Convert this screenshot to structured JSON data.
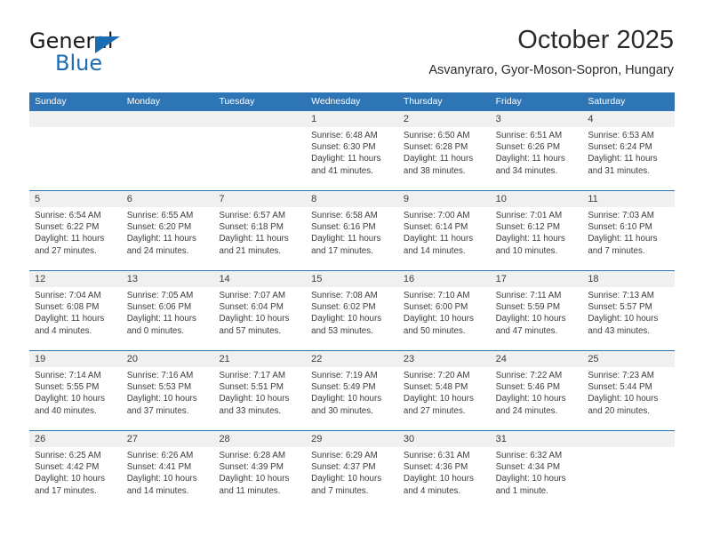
{
  "brand": {
    "name_part1": "General",
    "name_part2": "Blue",
    "triangle_color": "#1b6cb3",
    "blue_color": "#1b6cb3"
  },
  "header": {
    "title": "October 2025",
    "subtitle": "Asvanyraro, Gyor-Moson-Sopron, Hungary",
    "accent_color": "#2e75b6"
  },
  "calendar": {
    "weekday_headers": [
      "Sunday",
      "Monday",
      "Tuesday",
      "Wednesday",
      "Thursday",
      "Friday",
      "Saturday"
    ],
    "weeks": [
      [
        {
          "day": "",
          "lines": []
        },
        {
          "day": "",
          "lines": []
        },
        {
          "day": "",
          "lines": []
        },
        {
          "day": "1",
          "lines": [
            "Sunrise: 6:48 AM",
            "Sunset: 6:30 PM",
            "Daylight: 11 hours",
            "and 41 minutes."
          ]
        },
        {
          "day": "2",
          "lines": [
            "Sunrise: 6:50 AM",
            "Sunset: 6:28 PM",
            "Daylight: 11 hours",
            "and 38 minutes."
          ]
        },
        {
          "day": "3",
          "lines": [
            "Sunrise: 6:51 AM",
            "Sunset: 6:26 PM",
            "Daylight: 11 hours",
            "and 34 minutes."
          ]
        },
        {
          "day": "4",
          "lines": [
            "Sunrise: 6:53 AM",
            "Sunset: 6:24 PM",
            "Daylight: 11 hours",
            "and 31 minutes."
          ]
        }
      ],
      [
        {
          "day": "5",
          "lines": [
            "Sunrise: 6:54 AM",
            "Sunset: 6:22 PM",
            "Daylight: 11 hours",
            "and 27 minutes."
          ]
        },
        {
          "day": "6",
          "lines": [
            "Sunrise: 6:55 AM",
            "Sunset: 6:20 PM",
            "Daylight: 11 hours",
            "and 24 minutes."
          ]
        },
        {
          "day": "7",
          "lines": [
            "Sunrise: 6:57 AM",
            "Sunset: 6:18 PM",
            "Daylight: 11 hours",
            "and 21 minutes."
          ]
        },
        {
          "day": "8",
          "lines": [
            "Sunrise: 6:58 AM",
            "Sunset: 6:16 PM",
            "Daylight: 11 hours",
            "and 17 minutes."
          ]
        },
        {
          "day": "9",
          "lines": [
            "Sunrise: 7:00 AM",
            "Sunset: 6:14 PM",
            "Daylight: 11 hours",
            "and 14 minutes."
          ]
        },
        {
          "day": "10",
          "lines": [
            "Sunrise: 7:01 AM",
            "Sunset: 6:12 PM",
            "Daylight: 11 hours",
            "and 10 minutes."
          ]
        },
        {
          "day": "11",
          "lines": [
            "Sunrise: 7:03 AM",
            "Sunset: 6:10 PM",
            "Daylight: 11 hours",
            "and 7 minutes."
          ]
        }
      ],
      [
        {
          "day": "12",
          "lines": [
            "Sunrise: 7:04 AM",
            "Sunset: 6:08 PM",
            "Daylight: 11 hours",
            "and 4 minutes."
          ]
        },
        {
          "day": "13",
          "lines": [
            "Sunrise: 7:05 AM",
            "Sunset: 6:06 PM",
            "Daylight: 11 hours",
            "and 0 minutes."
          ]
        },
        {
          "day": "14",
          "lines": [
            "Sunrise: 7:07 AM",
            "Sunset: 6:04 PM",
            "Daylight: 10 hours",
            "and 57 minutes."
          ]
        },
        {
          "day": "15",
          "lines": [
            "Sunrise: 7:08 AM",
            "Sunset: 6:02 PM",
            "Daylight: 10 hours",
            "and 53 minutes."
          ]
        },
        {
          "day": "16",
          "lines": [
            "Sunrise: 7:10 AM",
            "Sunset: 6:00 PM",
            "Daylight: 10 hours",
            "and 50 minutes."
          ]
        },
        {
          "day": "17",
          "lines": [
            "Sunrise: 7:11 AM",
            "Sunset: 5:59 PM",
            "Daylight: 10 hours",
            "and 47 minutes."
          ]
        },
        {
          "day": "18",
          "lines": [
            "Sunrise: 7:13 AM",
            "Sunset: 5:57 PM",
            "Daylight: 10 hours",
            "and 43 minutes."
          ]
        }
      ],
      [
        {
          "day": "19",
          "lines": [
            "Sunrise: 7:14 AM",
            "Sunset: 5:55 PM",
            "Daylight: 10 hours",
            "and 40 minutes."
          ]
        },
        {
          "day": "20",
          "lines": [
            "Sunrise: 7:16 AM",
            "Sunset: 5:53 PM",
            "Daylight: 10 hours",
            "and 37 minutes."
          ]
        },
        {
          "day": "21",
          "lines": [
            "Sunrise: 7:17 AM",
            "Sunset: 5:51 PM",
            "Daylight: 10 hours",
            "and 33 minutes."
          ]
        },
        {
          "day": "22",
          "lines": [
            "Sunrise: 7:19 AM",
            "Sunset: 5:49 PM",
            "Daylight: 10 hours",
            "and 30 minutes."
          ]
        },
        {
          "day": "23",
          "lines": [
            "Sunrise: 7:20 AM",
            "Sunset: 5:48 PM",
            "Daylight: 10 hours",
            "and 27 minutes."
          ]
        },
        {
          "day": "24",
          "lines": [
            "Sunrise: 7:22 AM",
            "Sunset: 5:46 PM",
            "Daylight: 10 hours",
            "and 24 minutes."
          ]
        },
        {
          "day": "25",
          "lines": [
            "Sunrise: 7:23 AM",
            "Sunset: 5:44 PM",
            "Daylight: 10 hours",
            "and 20 minutes."
          ]
        }
      ],
      [
        {
          "day": "26",
          "lines": [
            "Sunrise: 6:25 AM",
            "Sunset: 4:42 PM",
            "Daylight: 10 hours",
            "and 17 minutes."
          ]
        },
        {
          "day": "27",
          "lines": [
            "Sunrise: 6:26 AM",
            "Sunset: 4:41 PM",
            "Daylight: 10 hours",
            "and 14 minutes."
          ]
        },
        {
          "day": "28",
          "lines": [
            "Sunrise: 6:28 AM",
            "Sunset: 4:39 PM",
            "Daylight: 10 hours",
            "and 11 minutes."
          ]
        },
        {
          "day": "29",
          "lines": [
            "Sunrise: 6:29 AM",
            "Sunset: 4:37 PM",
            "Daylight: 10 hours",
            "and 7 minutes."
          ]
        },
        {
          "day": "30",
          "lines": [
            "Sunrise: 6:31 AM",
            "Sunset: 4:36 PM",
            "Daylight: 10 hours",
            "and 4 minutes."
          ]
        },
        {
          "day": "31",
          "lines": [
            "Sunrise: 6:32 AM",
            "Sunset: 4:34 PM",
            "Daylight: 10 hours",
            "and 1 minute."
          ]
        },
        {
          "day": "",
          "lines": []
        }
      ]
    ]
  }
}
